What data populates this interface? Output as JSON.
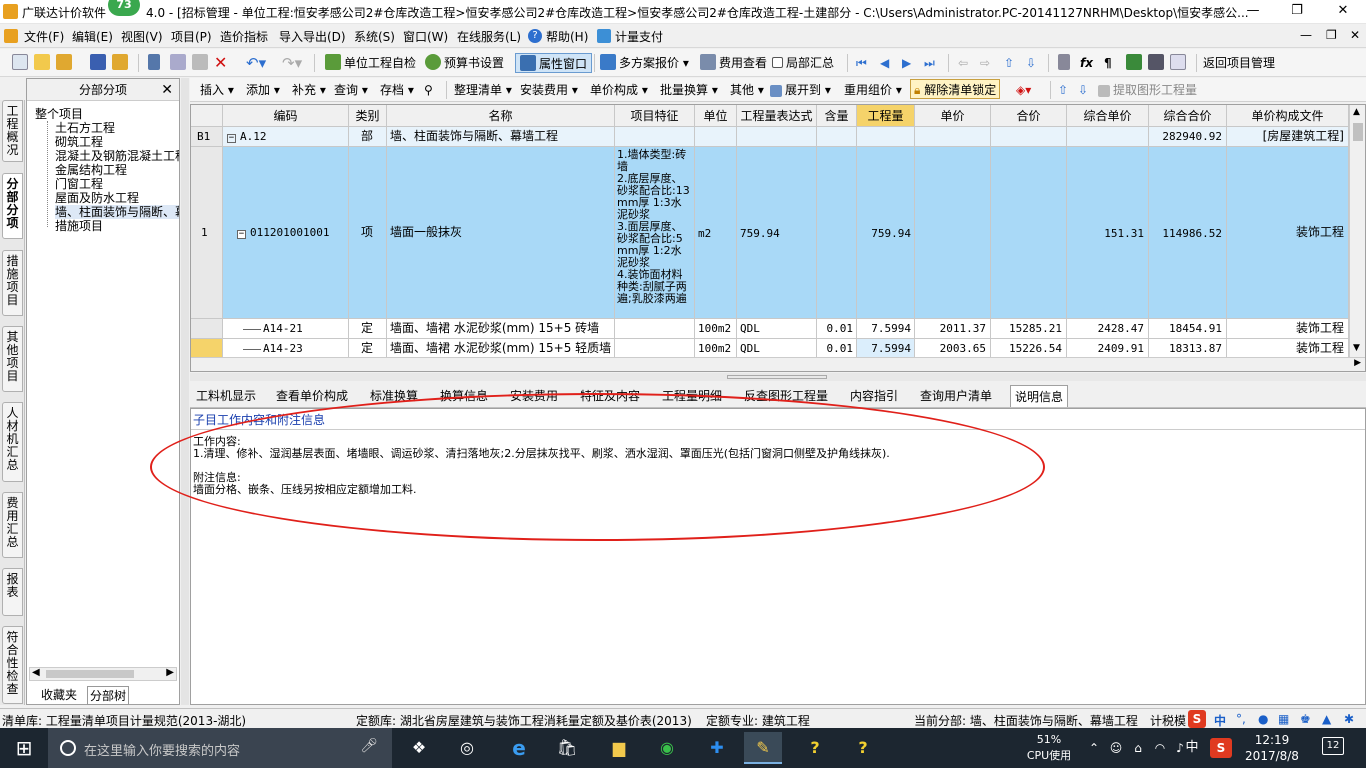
{
  "window": {
    "title_prefix": "广联达计价软件",
    "title_badge": "73",
    "title_text": "4.0 - [招标管理 - 单位工程:恒安孝感公司2#仓库改造工程>恒安孝感公司2#仓库改造工程>恒安孝感公司2#仓库改造工程-土建部分 - C:\\Users\\Administrator.PC-20141127NRHM\\Desktop\\恒安孝感公...",
    "minimize": "—",
    "restore": "❐",
    "close": "✕",
    "child_min": "—",
    "child_restore": "❐",
    "child_close": "✕"
  },
  "menu": [
    {
      "label": "文件(F)"
    },
    {
      "label": "编辑(E)"
    },
    {
      "label": "视图(V)"
    },
    {
      "label": "项目(P)"
    },
    {
      "label": "造价指标"
    },
    {
      "label": "导入导出(D)"
    },
    {
      "label": "系统(S)"
    },
    {
      "label": "窗口(W)"
    },
    {
      "label": "在线服务(L)"
    },
    {
      "label": "帮助(H)"
    },
    {
      "label": "计量支付"
    }
  ],
  "toolbar1": {
    "self_check": "单位工程自检",
    "budget_settings": "预算书设置",
    "property_window": "属性窗口",
    "multi_quote": "多方案报价",
    "fee_view": "费用查看",
    "partial_summary": "局部汇总",
    "return_project": "返回项目管理"
  },
  "left_tabs": [
    "工程概况",
    "分部分项",
    "措施项目",
    "其他项目",
    "人材机汇总",
    "费用汇总",
    "报表",
    "符合性检查"
  ],
  "tree": {
    "header": "分部分项",
    "close": "✕",
    "root": "整个项目",
    "items": [
      "土石方工程",
      "砌筑工程",
      "混凝土及钢筋混凝土工程",
      "金属结构工程",
      "门窗工程",
      "屋面及防水工程",
      "墙、柱面装饰与隔断、幕墙工程",
      "措施项目"
    ],
    "bottom_tabs": [
      "收藏夹",
      "分部树"
    ]
  },
  "toolbar2": {
    "insert": "插入",
    "add": "添加",
    "supplement": "补充",
    "query": "查询",
    "archive": "存档",
    "organize": "整理清单",
    "install_fee": "安装费用",
    "unit_price_comp": "单价构成",
    "batch_convert": "批量换算",
    "other": "其他",
    "expand_to": "展开到",
    "reuse_group": "重用组价",
    "unlock": "解除清单锁定",
    "extract_graphic": "提取图形工程量"
  },
  "grid": {
    "headers": [
      "编码",
      "类别",
      "名称",
      "项目特征",
      "单位",
      "工程量表达式",
      "含量",
      "工程量",
      "单价",
      "合价",
      "综合单价",
      "综合合价",
      "单价构成文件"
    ],
    "rows": [
      {
        "no": "B1",
        "code": "A.12",
        "type": "部",
        "name": "墙、柱面装饰与隔断、幕墙工程",
        "feature": "",
        "unit": "",
        "expr": "",
        "content": "",
        "qty": "",
        "price": "",
        "total": "",
        "comp_price": "",
        "comp_total": "282940.92",
        "file": "[房屋建筑工程]"
      },
      {
        "no": "1",
        "code": "011201001001",
        "type": "项",
        "name": "墙面一般抹灰",
        "feature": "1.墙体类型:砖墙\n2.底层厚度、砂浆配合比:13mm厚 1:3水泥砂浆\n3.面层厚度、砂浆配合比:5mm厚 1:2水泥砂浆\n4.装饰面材料种类:刮腻子两遍;乳胶漆两遍",
        "unit": "m2",
        "expr": "759.94",
        "content": "",
        "qty": "759.94",
        "price": "",
        "total": "",
        "comp_price": "151.31",
        "comp_total": "114986.52",
        "file": "装饰工程"
      },
      {
        "no": "",
        "code": "A14-21",
        "type": "定",
        "name": "墙面、墙裙 水泥砂浆(mm) 15+5 砖墙",
        "feature": "",
        "unit": "100m2",
        "expr": "QDL",
        "content": "0.01",
        "qty": "7.5994",
        "price": "2011.37",
        "total": "15285.21",
        "comp_price": "2428.47",
        "comp_total": "18454.91",
        "file": "装饰工程"
      },
      {
        "no": "",
        "code": "A14-23",
        "type": "定",
        "name": "墙面、墙裙 水泥砂浆(mm) 15+5 轻质墙",
        "feature": "",
        "unit": "100m2",
        "expr": "QDL",
        "content": "0.01",
        "qty": "7.5994",
        "price": "2003.65",
        "total": "15226.54",
        "comp_price": "2409.91",
        "comp_total": "18313.87",
        "file": "装饰工程"
      }
    ]
  },
  "bottom_tabs": [
    "工料机显示",
    "查看单价构成",
    "标准换算",
    "换算信息",
    "安装费用",
    "特征及内容",
    "工程量明细",
    "反查图形工程量",
    "内容指引",
    "查询用户清单",
    "说明信息"
  ],
  "info": {
    "title": "子目工作内容和附注信息",
    "work_label": "工作内容:",
    "work_text": "1.清理、修补、湿润基层表面、堵墙眼、调运砂浆、清扫落地灰;2.分层抹灰找平、刷浆、洒水湿润、罩面压光(包括门窗洞口侧壁及护角线抹灰).",
    "note_label": "附注信息:",
    "note_text": "墙面分格、嵌条、压线另按相应定额增加工料."
  },
  "status": {
    "list_lib": "清单库:  工程量清单项目计量规范(2013-湖北)",
    "quota_lib": "定额库:  湖北省房屋建筑与装饰工程消耗量定额及基价表(2013)",
    "quota_major": "定额专业:  建筑工程",
    "current_part": "当前分部:  墙、柱面装饰与隔断、幕墙工程",
    "calc_mode": "计税模",
    "ime": "中"
  },
  "taskbar": {
    "search_placeholder": "在这里输入你要搜索的内容",
    "cpu_value": "51%",
    "cpu_label": "CPU使用",
    "lang": "中",
    "time": "12:19",
    "date": "2017/8/8",
    "notif": "12"
  },
  "colors": {
    "accent": "#0078d7",
    "selection": "#a9d9f7",
    "annotation": "#e0201a",
    "info_title": "#1a3fae",
    "taskbar": "#1c2630"
  }
}
